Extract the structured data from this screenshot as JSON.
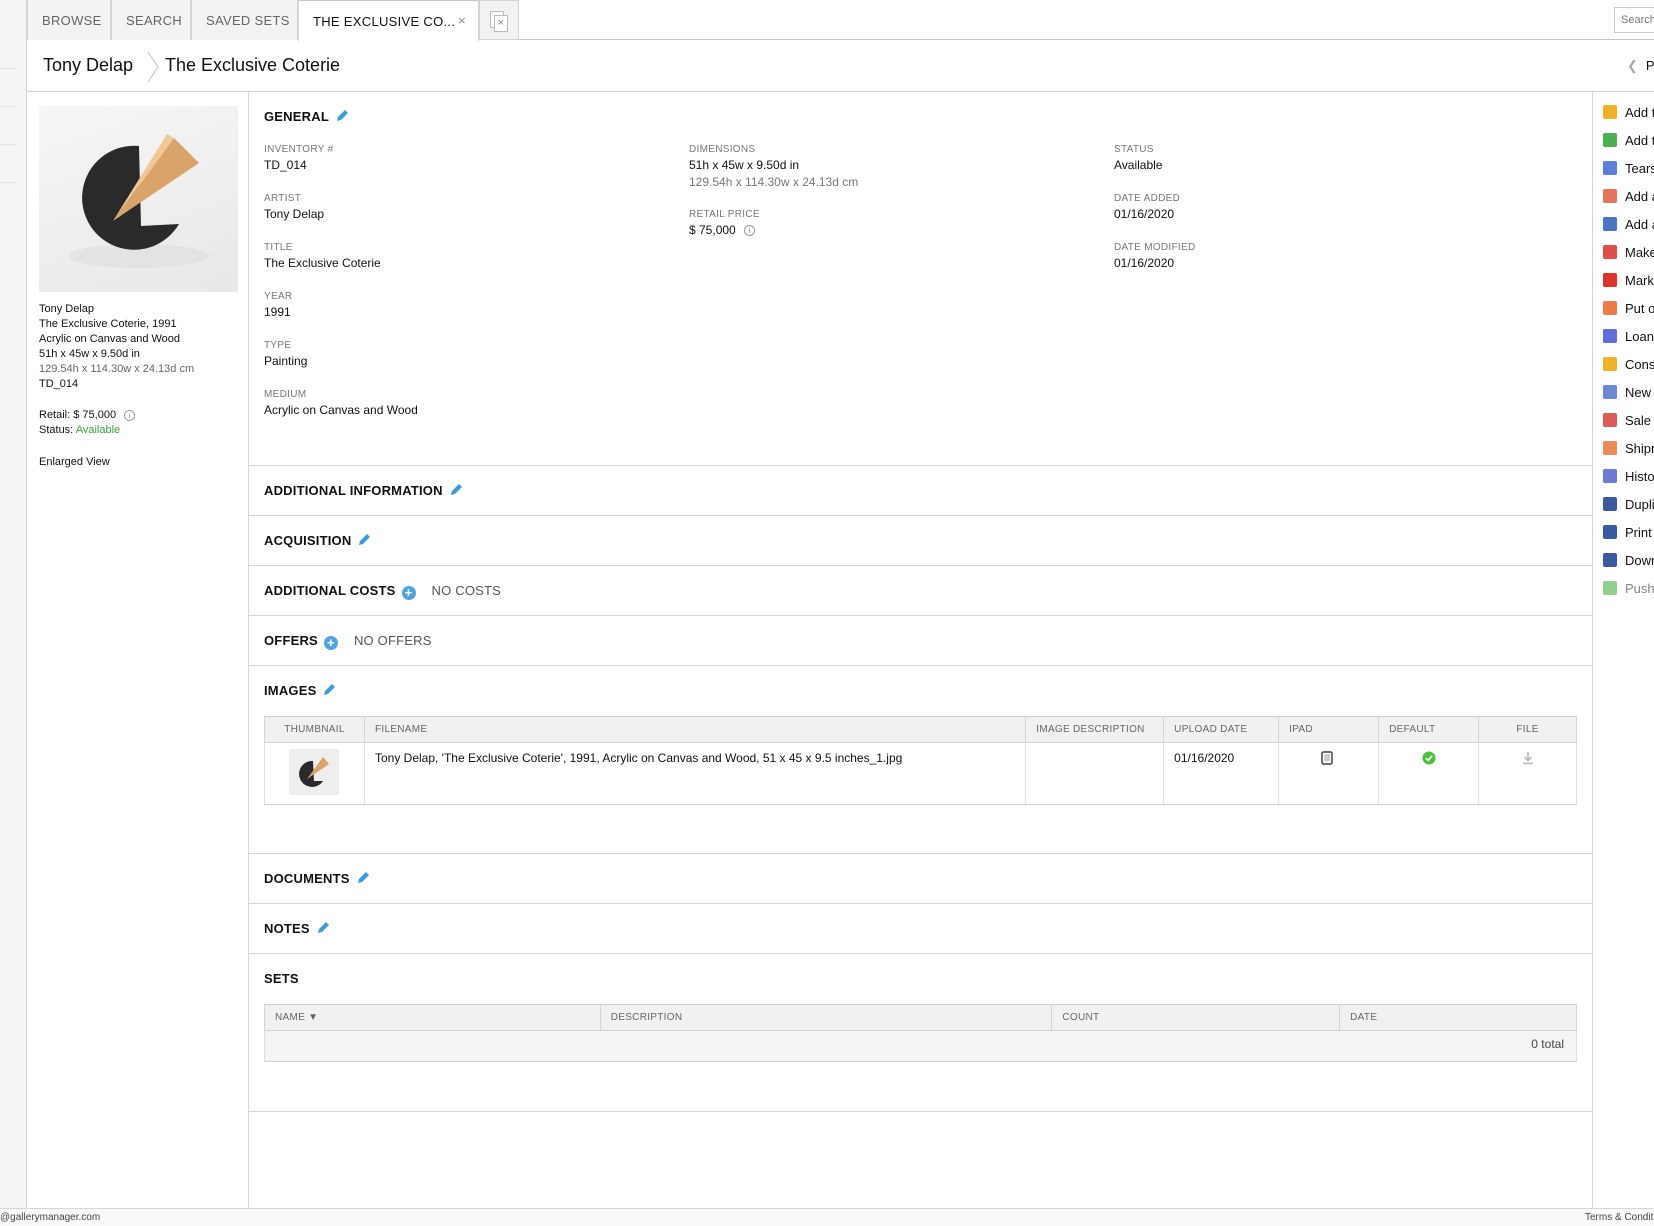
{
  "tabs": [
    {
      "label": "BROWSE"
    },
    {
      "label": "SEARCH"
    },
    {
      "label": "SAVED SETS"
    },
    {
      "label": "THE EXCLUSIVE CO...",
      "close": "×"
    }
  ],
  "search_placeholder": "Search Inve",
  "breadcrumb": {
    "artist": "Tony Delap",
    "title": "The Exclusive Coterie"
  },
  "prev_label": "Previo",
  "sidebar": {
    "artist": "Tony Delap",
    "title_year": "The Exclusive Coterie, 1991",
    "medium": "Acrylic on Canvas and Wood",
    "dims_in": "51h x 45w x 9.50d in",
    "dims_cm": "129.54h x 114.30w x 24.13d cm",
    "inventory": "TD_014",
    "retail_label": "Retail:",
    "retail_value": "$ 75,000",
    "status_label": "Status:",
    "status_value": "Available",
    "enlarged_view": "Enlarged View"
  },
  "general": {
    "heading": "GENERAL",
    "inventory_label": "INVENTORY #",
    "inventory_value": "TD_014",
    "artist_label": "ARTIST",
    "artist_value": "Tony Delap",
    "title_label": "TITLE",
    "title_value": "The Exclusive Coterie",
    "year_label": "YEAR",
    "year_value": "1991",
    "type_label": "TYPE",
    "type_value": "Painting",
    "medium_label": "MEDIUM",
    "medium_value": "Acrylic on Canvas and Wood",
    "dimensions_label": "DIMENSIONS",
    "dimensions_in": "51h x 45w x 9.50d in",
    "dimensions_cm": "129.54h x 114.30w x 24.13d cm",
    "retail_label": "RETAIL PRICE",
    "retail_value": "$ 75,000",
    "status_label": "STATUS",
    "status_value": "Available",
    "date_added_label": "DATE ADDED",
    "date_added_value": "01/16/2020",
    "date_modified_label": "DATE MODIFIED",
    "date_modified_value": "01/16/2020"
  },
  "sections": {
    "additional_info": "ADDITIONAL INFORMATION",
    "acquisition": "ACQUISITION",
    "additional_costs": "ADDITIONAL COSTS",
    "no_costs": "No Costs",
    "offers": "OFFERS",
    "no_offers": "No Offers",
    "images": "IMAGES",
    "documents": "DOCUMENTS",
    "notes": "NOTES",
    "sets": "SETS"
  },
  "images_table": {
    "headers": [
      "THUMBNAIL",
      "FILENAME",
      "IMAGE DESCRIPTION",
      "UPLOAD DATE",
      "IPAD",
      "DEFAULT",
      "FILE"
    ],
    "rows": [
      {
        "filename": "Tony Delap, 'The Exclusive Coterie', 1991, Acrylic on Canvas and Wood, 51 x 45 x 9.5 inches_1.jpg",
        "description": "",
        "upload_date": "01/16/2020"
      }
    ]
  },
  "sets_table": {
    "headers": [
      "NAME ▼",
      "DESCRIPTION",
      "COUNT",
      "DATE"
    ],
    "total": "0 total"
  },
  "actions": [
    {
      "label": "Add t",
      "color": "#f0b429",
      "icon": "add-to-folder-icon"
    },
    {
      "label": "Add t",
      "color": "#4caf50",
      "icon": "add-to-list-icon"
    },
    {
      "label": "Tears",
      "color": "#5b7fd6",
      "icon": "tearsheet-icon"
    },
    {
      "label": "Add a",
      "color": "#e8735a",
      "icon": "add-appointment-icon"
    },
    {
      "label": "Add a",
      "color": "#4a74c4",
      "icon": "add-image-icon"
    },
    {
      "label": "Make",
      "color": "#e04b4b",
      "icon": "unavailable-icon"
    },
    {
      "label": "Mark",
      "color": "#e0302f",
      "icon": "mark-sold-icon"
    },
    {
      "label": "Put o",
      "color": "#f07a4a",
      "icon": "hold-hand-icon"
    },
    {
      "label": "Loan",
      "color": "#5a6ee0",
      "icon": "loan-icon"
    },
    {
      "label": "Cons",
      "color": "#f0b429",
      "icon": "consign-icon"
    },
    {
      "label": "New (",
      "color": "#6a8ad6",
      "icon": "new-contact-icon"
    },
    {
      "label": "Sale",
      "color": "#e05a5a",
      "icon": "sale-tag-icon"
    },
    {
      "label": "Shipn",
      "color": "#f08a5a",
      "icon": "shipment-truck-icon"
    },
    {
      "label": "Histo",
      "color": "#6a7ad6",
      "icon": "history-icon"
    },
    {
      "label": "Dupli",
      "color": "#3a5aa0",
      "icon": "duplicate-icon"
    },
    {
      "label": "Print",
      "color": "#3a5aa0",
      "icon": "print-icon"
    },
    {
      "label": "Down",
      "color": "#3a5aa0",
      "icon": "download-icon"
    },
    {
      "label": "Push",
      "color": "#8fd08f",
      "icon": "push-arrow-icon"
    }
  ],
  "footer": {
    "left": "@gallerymanager.com",
    "right": "Terms & Conditi"
  }
}
